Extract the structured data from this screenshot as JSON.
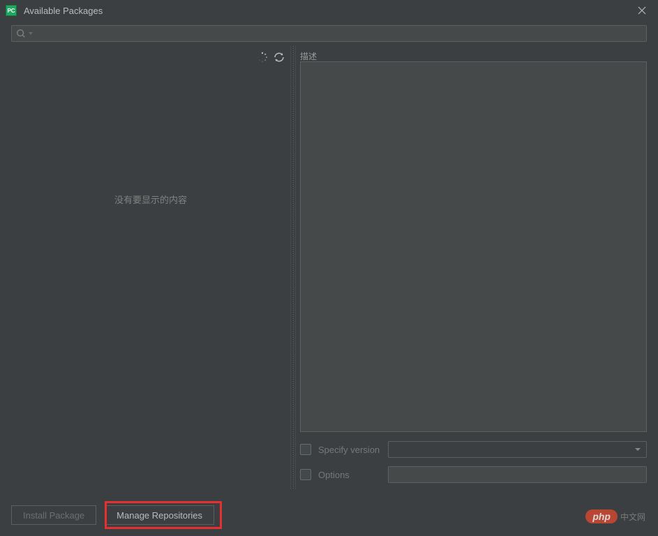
{
  "titlebar": {
    "app_icon_text": "PC",
    "title": "Available Packages"
  },
  "search": {
    "value": "",
    "placeholder": ""
  },
  "left_panel": {
    "empty_message": "没有要显示的内容"
  },
  "right_panel": {
    "description_label": "描述",
    "specify_version": {
      "label": "Specify version",
      "checked": false,
      "value": ""
    },
    "options": {
      "label": "Options",
      "checked": false,
      "value": ""
    }
  },
  "buttons": {
    "install": "Install Package",
    "manage_repos": "Manage Repositories"
  },
  "watermark": {
    "badge": "php",
    "text": "中文网"
  },
  "highlight": {
    "target": "manage-repositories-button"
  }
}
